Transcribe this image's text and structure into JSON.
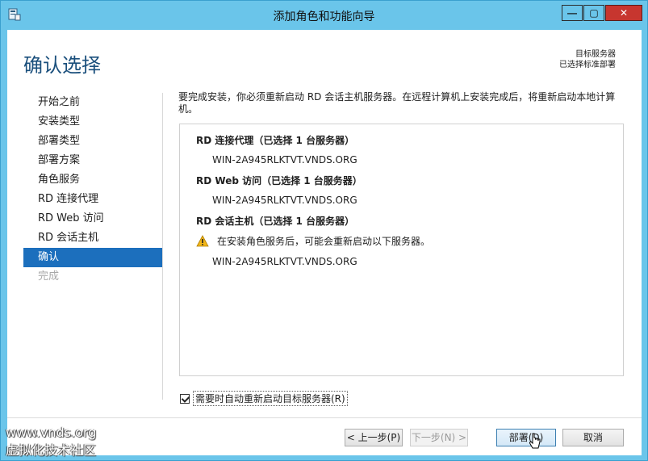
{
  "window": {
    "title": "添加角色和功能向导",
    "minimize": "—",
    "maximize": "▢",
    "close": "✕"
  },
  "page": {
    "title": "确认选择",
    "target_label": "目标服务器",
    "target_value": "已选择标准部署"
  },
  "nav": {
    "items": [
      {
        "label": "开始之前"
      },
      {
        "label": "安装类型"
      },
      {
        "label": "部署类型"
      },
      {
        "label": "部署方案"
      },
      {
        "label": "角色服务"
      },
      {
        "label": "RD 连接代理"
      },
      {
        "label": "RD Web 访问"
      },
      {
        "label": "RD 会话主机"
      },
      {
        "label": "确认"
      },
      {
        "label": "完成"
      }
    ],
    "active_index": 8
  },
  "content": {
    "intro": "要完成安装，你必须重新启动 RD 会话主机服务器。在远程计算机上安装完成后，将重新启动本地计算机。",
    "sections": [
      {
        "heading": "RD 连接代理（已选择 1 台服务器）",
        "server": "WIN-2A945RLKTVT.VNDS.ORG"
      },
      {
        "heading": "RD Web 访问（已选择 1 台服务器）",
        "server": "WIN-2A945RLKTVT.VNDS.ORG"
      },
      {
        "heading": "RD 会话主机（已选择 1 台服务器）",
        "warning": "在安装角色服务后，可能会重新启动以下服务器。",
        "server": "WIN-2A945RLKTVT.VNDS.ORG"
      }
    ],
    "restart_checkbox": "需要时自动重新启动目标服务器(R)"
  },
  "buttons": {
    "prev": "< 上一步(P)",
    "next": "下一步(N) >",
    "deploy": "部署(D)",
    "cancel": "取消"
  },
  "watermark": {
    "line1": "www.vnds.org",
    "line2": "虚拟化技术社区"
  },
  "colors": {
    "accent": "#1c6fbd",
    "titlebar": "#6ac5ea",
    "close": "#c7362f",
    "warning": "#f2b618"
  }
}
